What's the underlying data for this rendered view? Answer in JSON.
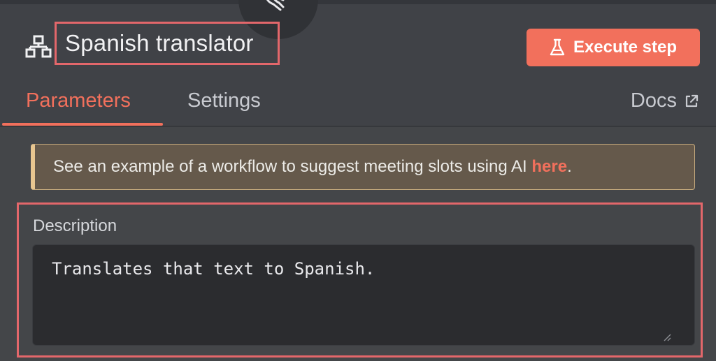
{
  "header": {
    "node_icon": "network-icon",
    "title": "Spanish translator",
    "execute_label": "Execute step",
    "execute_icon": "flask-icon",
    "accent_color": "#f2705c"
  },
  "tabs": [
    {
      "label": "Parameters",
      "active": true
    },
    {
      "label": "Settings",
      "active": false
    }
  ],
  "docs": {
    "label": "Docs",
    "icon": "external-link-icon"
  },
  "callout": {
    "text_before": "See an example of a workflow to suggest meeting slots using AI ",
    "link_text": "here",
    "text_after": "."
  },
  "description": {
    "label": "Description",
    "value": "Translates that text to Spanish."
  }
}
